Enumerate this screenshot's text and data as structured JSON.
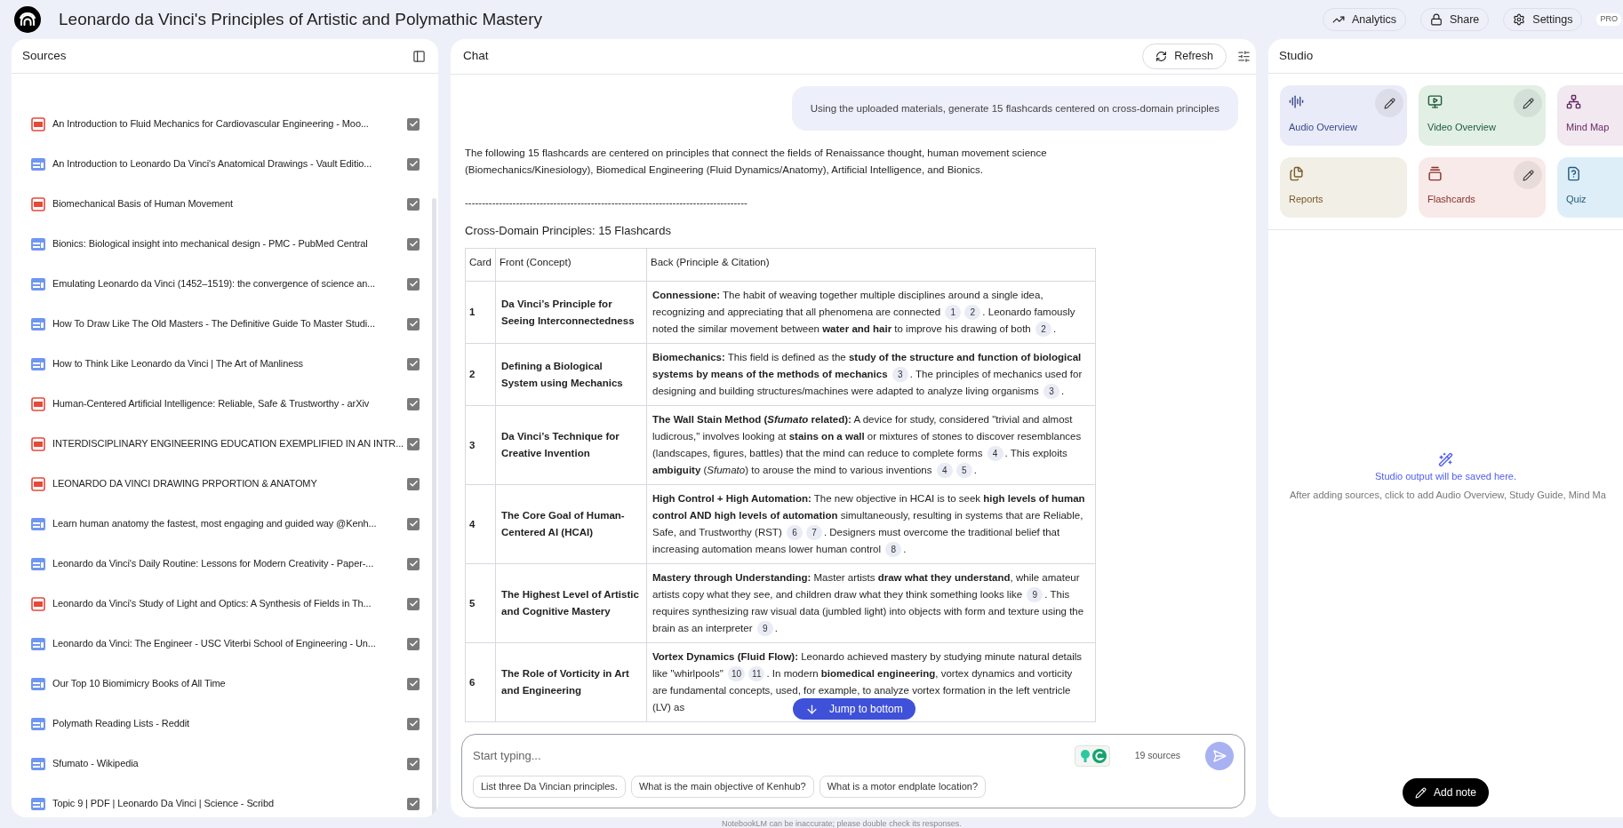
{
  "header": {
    "title": "Leonardo da Vinci's Principles of Artistic and Polymathic Mastery",
    "buttons": [
      {
        "kind": "analytics",
        "label": "Analytics"
      },
      {
        "kind": "share",
        "label": "Share"
      },
      {
        "kind": "settings",
        "label": "Settings"
      }
    ],
    "badge": "PRO"
  },
  "sources": {
    "title": "Sources",
    "items": [
      {
        "kind": "pdf",
        "title": "An Introduction to Fluid Mechanics for Cardiovascular Engineering - Moo...",
        "checked": true
      },
      {
        "kind": "web",
        "title": "An Introduction to Leonardo Da Vinci's Anatomical Drawings - Vault Editio...",
        "checked": true
      },
      {
        "kind": "pdf",
        "title": "Biomechanical Basis of Human Movement",
        "checked": true
      },
      {
        "kind": "web",
        "title": "Bionics: Biological insight into mechanical design - PMC - PubMed Central",
        "checked": true
      },
      {
        "kind": "web",
        "title": "Emulating Leonardo da Vinci (1452–1519): the convergence of science an...",
        "checked": true
      },
      {
        "kind": "web",
        "title": "How To Draw Like The Old Masters - The Definitive Guide To Master Studi...",
        "checked": true
      },
      {
        "kind": "web",
        "title": "How to Think Like Leonardo da Vinci | The Art of Manliness",
        "checked": true
      },
      {
        "kind": "pdf",
        "title": "Human-Centered Artificial Intelligence: Reliable, Safe & Trustworthy - arXiv",
        "checked": true
      },
      {
        "kind": "pdf",
        "title": "INTERDISCIPLINARY ENGINEERING EDUCATION EXEMPLIFIED IN AN INTR...",
        "checked": true
      },
      {
        "kind": "pdf",
        "title": "LEONARDO DA VINCI DRAWING PRPORTION & ANATOMY",
        "checked": true
      },
      {
        "kind": "web",
        "title": "Learn human anatomy the fastest, most engaging and guided way @Kenh...",
        "checked": true
      },
      {
        "kind": "web",
        "title": "Leonardo da Vinci's Daily Routine: Lessons for Modern Creativity - Paper-...",
        "checked": true
      },
      {
        "kind": "pdf",
        "title": "Leonardo da Vinci's Study of Light and Optics: A Synthesis of Fields in Th...",
        "checked": true
      },
      {
        "kind": "web",
        "title": "Leonardo da Vinci: The Engineer - USC Viterbi School of Engineering - Un...",
        "checked": true
      },
      {
        "kind": "web",
        "title": "Our Top 10 Biomimicry Books of All Time",
        "checked": true
      },
      {
        "kind": "web",
        "title": "Polymath Reading Lists - Reddit",
        "checked": true
      },
      {
        "kind": "web",
        "title": "Sfumato - Wikipedia",
        "checked": true
      },
      {
        "kind": "web",
        "title": "Topic 9 | PDF | Leonardo Da Vinci | Science - Scribd",
        "checked": true
      }
    ]
  },
  "chat": {
    "title": "Chat",
    "refresh": "Refresh",
    "user_message": "Using the uploaded materials, generate 15 flashcards centered on cross-domain principles",
    "intro": "The following 15 flashcards are centered on principles that connect the fields of Renaissance thought, human movement science (Biomechanics/Kinesiology), Biomedical Engineering (Fluid Dynamics/Anatomy), Artificial Intelligence, and Bionics.",
    "divider": "-----------------------------------------------------------------------------------",
    "heading": "Cross-Domain Principles: 15 Flashcards",
    "table": {
      "columns": [
        "Card",
        "Front (Concept)",
        "Back (Principle & Citation)"
      ],
      "rows": [
        {
          "card": "1",
          "front": "Da Vinci’s Principle for Seeing Interconnectedness",
          "back": [
            {
              "kind": "text",
              "text": "**Connessione:** The habit of weaving together multiple disciplines around a single idea, recognizing and appreciating that all phenomena are connected "
            },
            {
              "kind": "cite",
              "text": "1"
            },
            {
              "kind": "cite",
              "text": "2"
            },
            {
              "kind": "text",
              "text": ". Leonardo famously noted the similar movement between **water and hair** to improve his drawing of both "
            },
            {
              "kind": "cite",
              "text": "2"
            },
            {
              "kind": "text",
              "text": "."
            }
          ]
        },
        {
          "card": "2",
          "front": "Defining a Biological System using Mechanics",
          "back": [
            {
              "kind": "text",
              "text": "**Biomechanics:** This field is defined as the **study of the structure and function of biological systems by means of the methods of mechanics** "
            },
            {
              "kind": "cite",
              "text": "3"
            },
            {
              "kind": "text",
              "text": ". The principles of mechanics used for designing and building structures/machines were adapted to analyze living organisms "
            },
            {
              "kind": "cite",
              "text": "3"
            },
            {
              "kind": "text",
              "text": "."
            }
          ]
        },
        {
          "card": "3",
          "front": "Da Vinci’s Technique for Creative Invention",
          "back": [
            {
              "kind": "text",
              "text": "**The Wall Stain Method (**"
            },
            {
              "kind": "bold_italic",
              "text": "Sfumato"
            },
            {
              "kind": "bold",
              "text": " related):"
            },
            {
              "kind": "text",
              "text": " A device for study, considered \"trivial and almost ludicrous,\" involves looking at **stains on a wall** or mixtures of stones to discover resemblances (landscapes, figures, battles) that the mind can reduce to complete forms "
            },
            {
              "kind": "cite",
              "text": "4"
            },
            {
              "kind": "text",
              "text": ". This exploits **ambiguity** (*Sfumato*) to arouse the mind to various inventions "
            },
            {
              "kind": "cite",
              "text": "4"
            },
            {
              "kind": "cite",
              "text": "5"
            },
            {
              "kind": "text",
              "text": "."
            }
          ]
        },
        {
          "card": "4",
          "front": "The Core Goal of Human-Centered AI (HCAI)",
          "back": [
            {
              "kind": "text",
              "text": "**High Control + High Automation:** The new objective in HCAI is to seek **high levels of human control AND high levels of automation** simultaneously, resulting in systems that are Reliable, Safe, and Trustworthy (RST) "
            },
            {
              "kind": "cite",
              "text": "6"
            },
            {
              "kind": "cite",
              "text": "7"
            },
            {
              "kind": "text",
              "text": ". Designers must overcome the traditional belief that increasing automation means lower human control "
            },
            {
              "kind": "cite",
              "text": "8"
            },
            {
              "kind": "text",
              "text": "."
            }
          ]
        },
        {
          "card": "5",
          "front": "The Highest Level of Artistic and Cognitive Mastery",
          "back": [
            {
              "kind": "text",
              "text": "**Mastery through Understanding:** Master artists **draw what they understand**, while amateur artists copy what they see, and children draw what they think something looks like "
            },
            {
              "kind": "cite",
              "text": "9"
            },
            {
              "kind": "text",
              "text": ". This requires synthesizing raw visual data (jumbled light) into objects with form and texture using the brain as an interpreter "
            },
            {
              "kind": "cite",
              "text": "9"
            },
            {
              "kind": "text",
              "text": "."
            }
          ]
        },
        {
          "card": "6",
          "front": "The Role of Vorticity in Art and Engineering",
          "back": [
            {
              "kind": "text",
              "text": "**Vortex Dynamics (Fluid Flow):** Leonardo achieved mastery by studying minute natural details like \"whirlpools\" "
            },
            {
              "kind": "cite",
              "text": "10"
            },
            {
              "kind": "cite",
              "text": "11"
            },
            {
              "kind": "text",
              "text": ". In modern **biomedical engineering**, vortex dynamics and vorticity are fundamental concepts, used, for example, to analyze vortex formation in the left ventricle (LV) as"
            }
          ]
        }
      ]
    },
    "jump": "Jump to bottom",
    "composer": {
      "placeholder": "Start typing...",
      "source_count": "19 sources",
      "suggestions": [
        "List three Da Vincian principles.",
        "What is the main objective of Kenhub?",
        "What is a motor endplate location?"
      ]
    },
    "disclaimer": "NotebookLM can be inaccurate; please double check its responses."
  },
  "studio": {
    "title": "Studio",
    "tools": [
      {
        "kind": "audio",
        "label": "Audio Overview",
        "editable": true
      },
      {
        "kind": "video",
        "label": "Video Overview",
        "editable": true
      },
      {
        "kind": "mindmap",
        "label": "Mind Map"
      },
      {
        "kind": "reports",
        "label": "Reports",
        "editable": false
      },
      {
        "kind": "flashcards",
        "label": "Flashcards",
        "editable": true
      },
      {
        "kind": "quiz",
        "label": "Quiz"
      }
    ],
    "empty_title": "Studio output will be saved here.",
    "empty_text": "After adding sources, click to add Audio Overview, Study Guide, Mind Ma",
    "add_note": "Add note"
  }
}
